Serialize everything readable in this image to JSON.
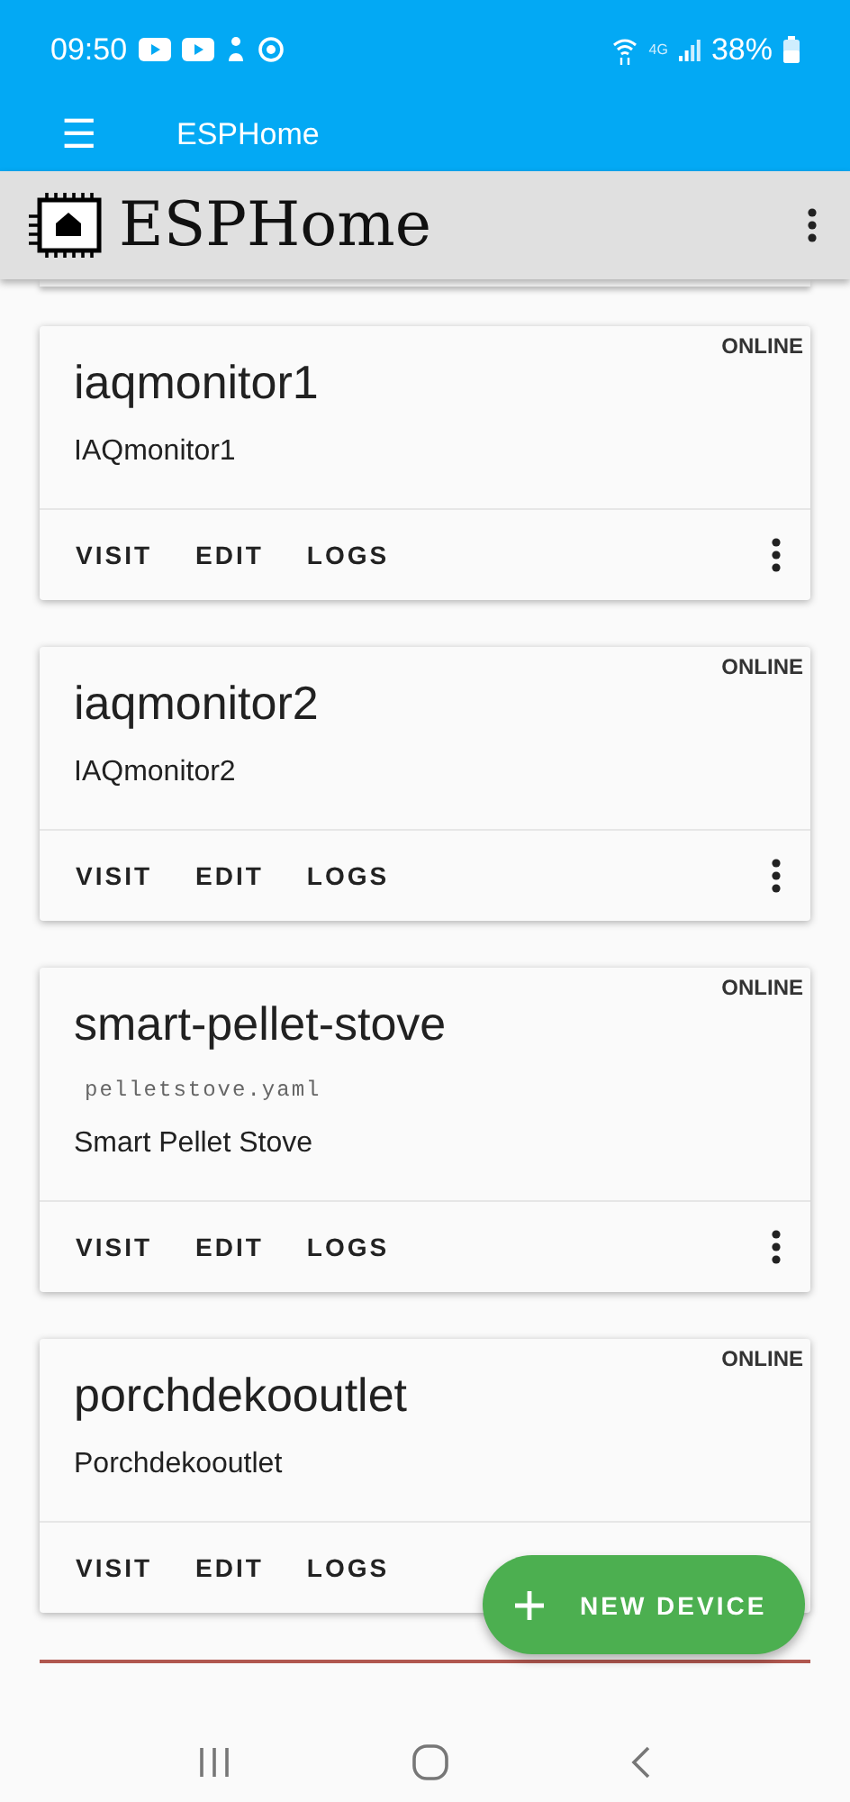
{
  "status_bar": {
    "time": "09:50",
    "network": "4G",
    "battery": "38%"
  },
  "app_bar": {
    "menu": "☰",
    "title": "ESPHome"
  },
  "header": {
    "title": "ESPHome"
  },
  "devices": [
    {
      "name": "iaqmonitor1",
      "status": "ONLINE",
      "friendly_name": "IAQmonitor1",
      "actions": [
        "VISIT",
        "EDIT",
        "LOGS"
      ],
      "menu_button": true
    },
    {
      "name": "iaqmonitor2",
      "status": "ONLINE",
      "friendly_name": "IAQmonitor2",
      "actions": [
        "VISIT",
        "EDIT",
        "LOGS"
      ],
      "menu_button": true
    },
    {
      "name": "smart-pellet-stove",
      "status": "ONLINE",
      "config_file": "pelletstove.yaml",
      "friendly_name": "Smart Pellet Stove",
      "actions": [
        "VISIT",
        "EDIT",
        "LOGS"
      ],
      "menu_button": true
    },
    {
      "name": "porchdekooutlet",
      "status": "ONLINE",
      "friendly_name": "Porchdekooutlet",
      "actions": [
        "VISIT",
        "EDIT",
        "LOGS"
      ],
      "menu_button": false
    }
  ],
  "fab": {
    "label": "NEW DEVICE"
  }
}
